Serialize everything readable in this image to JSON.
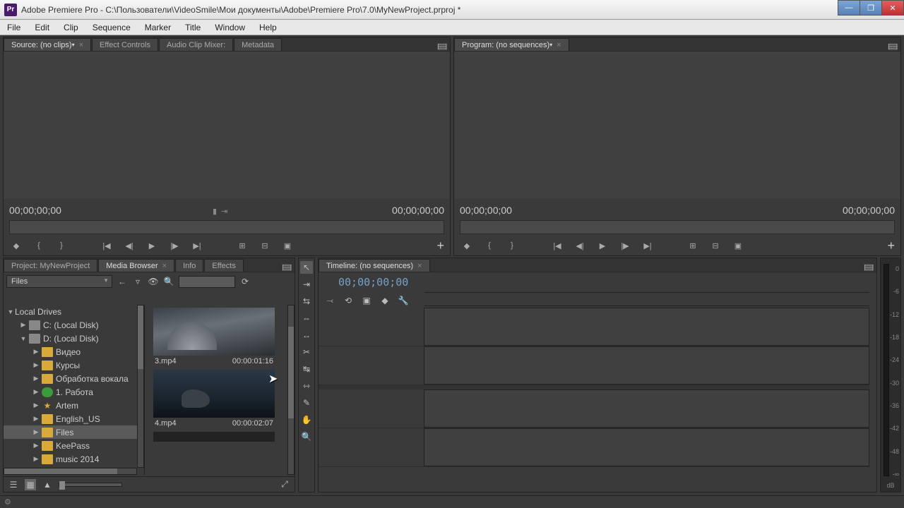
{
  "title_bar": {
    "app_icon": "Pr",
    "title": "Adobe Premiere Pro - C:\\Пользователи\\VideoSmile\\Мои документы\\Adobe\\Premiere Pro\\7.0\\MyNewProject.prproj *"
  },
  "menu": [
    "File",
    "Edit",
    "Clip",
    "Sequence",
    "Marker",
    "Title",
    "Window",
    "Help"
  ],
  "source_panel": {
    "tabs": [
      {
        "label": "Source: (no clips)",
        "active": true,
        "closable": true,
        "dropdown": true
      },
      {
        "label": "Effect Controls"
      },
      {
        "label": "Audio Clip Mixer: "
      },
      {
        "label": "Metadata"
      }
    ],
    "time_left": "00;00;00;00",
    "time_right": "00;00;00;00"
  },
  "program_panel": {
    "tabs": [
      {
        "label": "Program: (no sequences)",
        "active": true,
        "closable": true,
        "dropdown": true
      }
    ],
    "time_left": "00;00;00;00",
    "time_right": "00;00;00;00"
  },
  "project_panel": {
    "tabs": [
      {
        "label": "Project: MyNewProject"
      },
      {
        "label": "Media Browser",
        "active": true,
        "closable": true
      },
      {
        "label": "Info"
      },
      {
        "label": "Effects"
      }
    ],
    "dropdown": "Files",
    "tree_root": "Local Drives",
    "tree": [
      {
        "label": "C: (Local Disk)",
        "icon": "drive",
        "indent": 1,
        "arrow": "closed"
      },
      {
        "label": "D: (Local Disk)",
        "icon": "drive",
        "indent": 1,
        "arrow": "open"
      },
      {
        "label": "Видео",
        "icon": "folder",
        "indent": 2,
        "arrow": "closed"
      },
      {
        "label": "Курсы",
        "icon": "folder",
        "indent": 2,
        "arrow": "closed"
      },
      {
        "label": "Обработка вокала",
        "icon": "folder",
        "indent": 2,
        "arrow": "closed"
      },
      {
        "label": "1. Работа",
        "icon": "green",
        "indent": 2,
        "arrow": "closed"
      },
      {
        "label": "Artem",
        "icon": "star",
        "indent": 2,
        "arrow": "closed"
      },
      {
        "label": "English_US",
        "icon": "folder",
        "indent": 2,
        "arrow": "closed"
      },
      {
        "label": "Files",
        "icon": "folder",
        "indent": 2,
        "selected": true,
        "arrow": "closed"
      },
      {
        "label": "KeePass",
        "icon": "folder",
        "indent": 2,
        "arrow": "closed"
      },
      {
        "label": "music 2014",
        "icon": "folder",
        "indent": 2,
        "arrow": "closed"
      }
    ],
    "thumbs": [
      {
        "name": "3.mp4",
        "dur": "00:00:01:16",
        "img": "car"
      },
      {
        "name": "4.mp4",
        "dur": "00:00:02:07",
        "img": "wolf"
      }
    ]
  },
  "timeline_panel": {
    "tabs": [
      {
        "label": "Timeline: (no sequences)",
        "active": true,
        "closable": true
      }
    ],
    "time": "00;00;00;00"
  },
  "meter": {
    "ticks": [
      "0",
      "-6",
      "-12",
      "-18",
      "-24",
      "-30",
      "-36",
      "-42",
      "-48",
      "-∞"
    ],
    "label": "dB"
  },
  "tools": [
    "selection",
    "track-select",
    "ripple",
    "rolling",
    "rate-stretch",
    "razor",
    "slip",
    "slide",
    "pen",
    "hand",
    "zoom"
  ]
}
